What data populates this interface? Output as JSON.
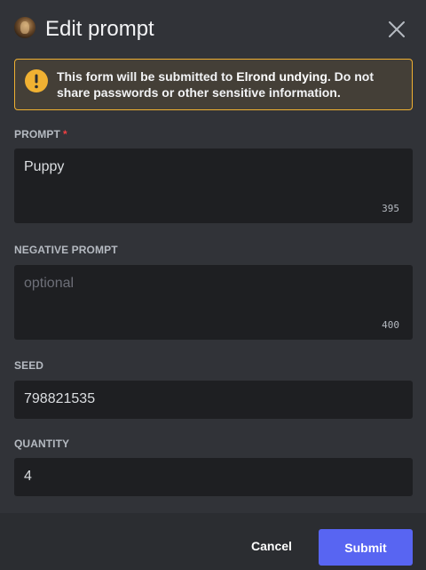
{
  "header": {
    "title": "Edit prompt",
    "avatar_icon": "app-avatar-icon",
    "close_icon": "close-icon"
  },
  "notice": {
    "icon": "warning-icon",
    "text_prefix": "This form will be submitted to ",
    "app_name": "Elrond undying",
    "text_suffix": ". Do not share passwords or other sensitive information.",
    "accent_color": "#f0b132"
  },
  "fields": {
    "prompt": {
      "label": "PROMPT",
      "required_mark": "*",
      "value": "Puppy",
      "counter": "395"
    },
    "negative_prompt": {
      "label": "NEGATIVE PROMPT",
      "placeholder": "optional",
      "value": "",
      "counter": "400"
    },
    "seed": {
      "label": "SEED",
      "value": "798821535"
    },
    "quantity": {
      "label": "QUANTITY",
      "value": "4"
    }
  },
  "footer": {
    "cancel_label": "Cancel",
    "submit_label": "Submit",
    "submit_color": "#5865f2"
  }
}
